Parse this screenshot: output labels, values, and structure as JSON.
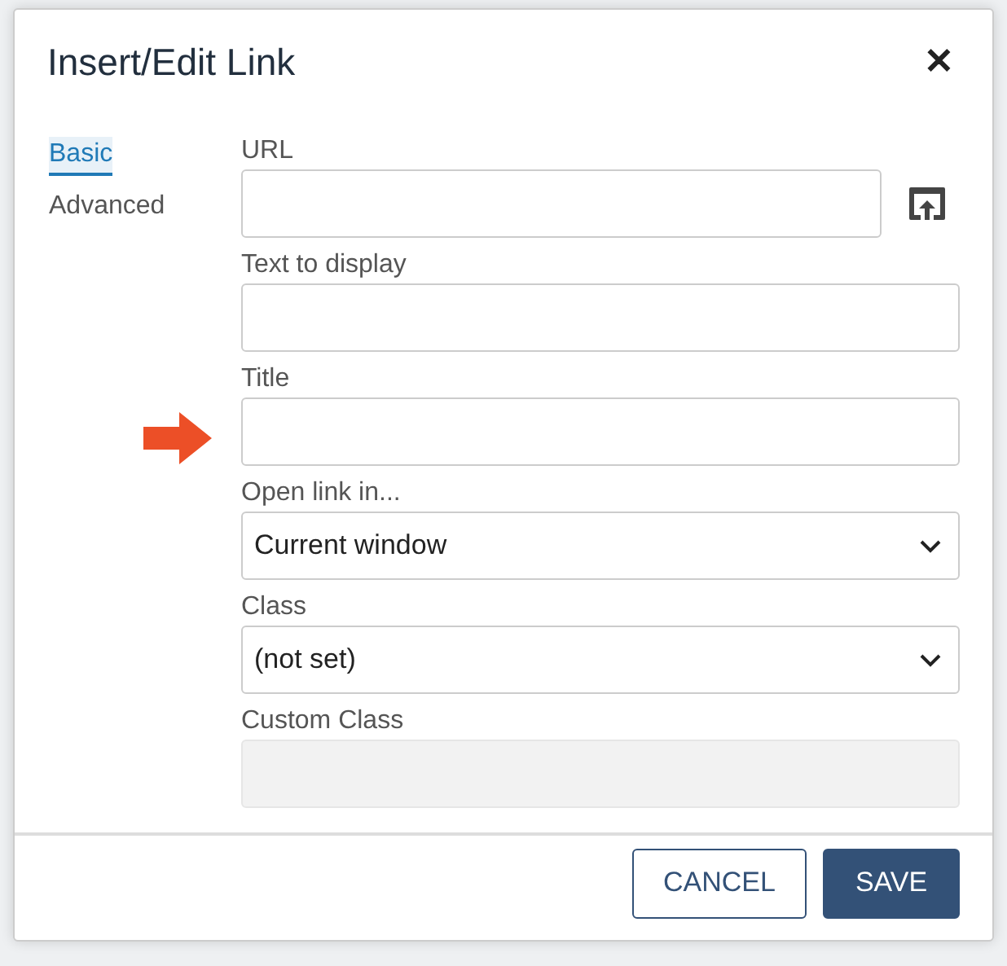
{
  "dialog": {
    "title": "Insert/Edit Link",
    "close": "✕"
  },
  "tabs": [
    {
      "label": "Basic",
      "selected": true
    },
    {
      "label": "Advanced",
      "selected": false
    }
  ],
  "fields": [
    {
      "kind": "text",
      "label": "URL",
      "browse": true,
      "disabled": false
    },
    {
      "kind": "text",
      "label": "Text to display",
      "disabled": false
    },
    {
      "kind": "text",
      "label": "Title",
      "pointer": true,
      "disabled": false
    },
    {
      "kind": "select",
      "label": "Open link in...",
      "value": "Current window",
      "disabled": false
    },
    {
      "kind": "select",
      "label": "Class",
      "value": "(not set)",
      "disabled": false
    },
    {
      "kind": "text",
      "label": "Custom Class",
      "disabled": true
    }
  ],
  "buttons": [
    {
      "label": "CANCEL",
      "kind": "secondary"
    },
    {
      "label": "SAVE",
      "kind": "primary"
    }
  ]
}
